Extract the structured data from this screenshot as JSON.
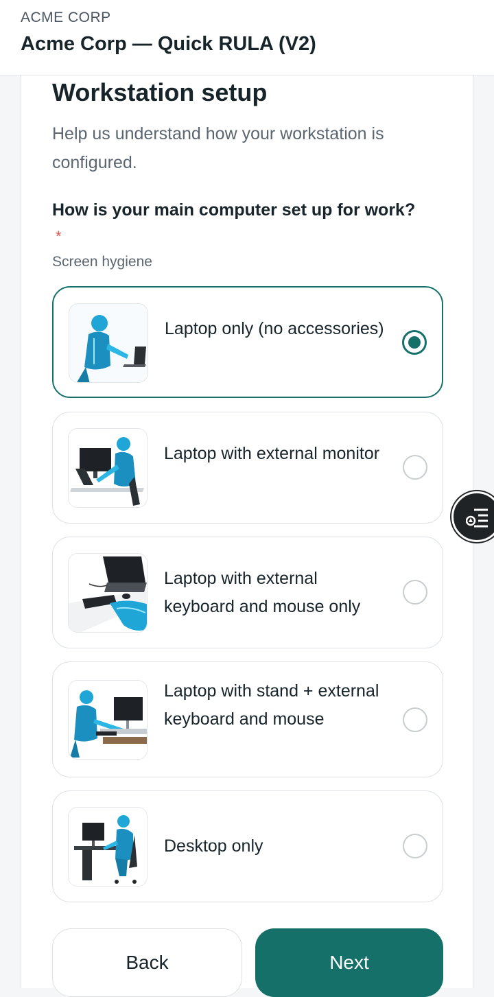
{
  "header": {
    "org_name": "ACME CORP",
    "form_title": "Acme Corp — Quick RULA (V2)"
  },
  "section": {
    "title": "Workstation setup",
    "description": "Help us understand how your workstation is configured."
  },
  "question": {
    "text": "How is your main computer set up for work?",
    "required_mark": "*",
    "hint": "Screen hygiene",
    "options": [
      {
        "label": "Laptop only (no accessories)",
        "selected": true,
        "image": "laptop-only-illustration"
      },
      {
        "label": "Laptop with external monitor",
        "selected": false,
        "image": "laptop-external-monitor-illustration"
      },
      {
        "label": "Laptop with external keyboard and mouse only",
        "selected": false,
        "image": "laptop-keyboard-mouse-illustration"
      },
      {
        "label": "Laptop with stand + external keyboard and mouse",
        "selected": false,
        "image": "laptop-stand-illustration"
      },
      {
        "label": "Desktop only",
        "selected": false,
        "image": "desktop-only-illustration"
      }
    ]
  },
  "buttons": {
    "back": "Back",
    "next": "Next"
  },
  "floating_button": {
    "icon": "list-options-icon"
  },
  "colors": {
    "accent": "#15706a",
    "required": "#d9534f",
    "skeleton": "#1fa6d6"
  }
}
